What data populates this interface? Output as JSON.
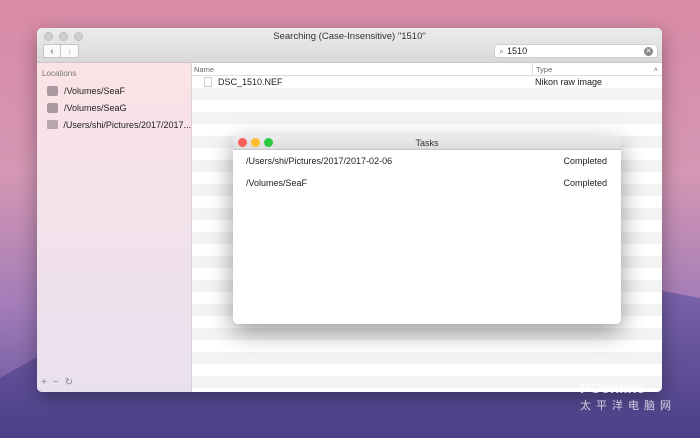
{
  "window": {
    "title": "Searching (Case-Insensitive) \"1510\""
  },
  "search": {
    "value": "1510"
  },
  "sidebar": {
    "header": "Locations",
    "items": [
      {
        "label": "/Volumes/SeaF",
        "icon": "drive-icon"
      },
      {
        "label": "/Volumes/SeaG",
        "icon": "drive-icon"
      },
      {
        "label": "/Users/shi/Pictures/2017/2017...",
        "icon": "folder-icon"
      }
    ],
    "footer": {
      "add": "+",
      "remove": "−",
      "refresh": "↻"
    }
  },
  "table": {
    "columns": [
      "Name",
      "Type"
    ],
    "rows": [
      {
        "name": "DSC_1510.NEF",
        "type": "Nikon raw image"
      }
    ]
  },
  "tasks": {
    "title": "Tasks",
    "rows": [
      {
        "path": "/Users/shi/Pictures/2017/2017-02-06",
        "status": "Completed"
      },
      {
        "path": "/Volumes/SeaF",
        "status": "Completed"
      }
    ]
  },
  "watermark": {
    "text": "PConline",
    "sub": "太平洋电脑网"
  }
}
